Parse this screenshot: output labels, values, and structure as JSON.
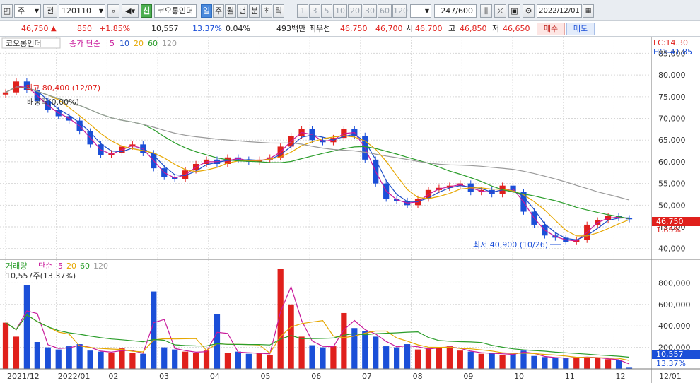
{
  "toolbar": {
    "period": "주",
    "prev_label": "전",
    "code": "120110",
    "badge": "신",
    "stock_name": "코오롱인더",
    "interval_tabs": [
      "일",
      "주",
      "월",
      "년",
      "분",
      "초",
      "틱"
    ],
    "active_interval": "일",
    "number_tabs": [
      "1",
      "3",
      "5",
      "10",
      "20",
      "30",
      "60",
      "120"
    ],
    "count": "247",
    "count_total": "/600",
    "date": "2022/12/01"
  },
  "quote": {
    "price": "46,750",
    "change_arrow": "▲",
    "change": "850",
    "change_pct": "+1.85%",
    "volume": "10,557",
    "volume_pct": "13.37%",
    "turnover": "0.04%",
    "amount": "493백만",
    "best_label": "최우선",
    "best_ask": "46,750",
    "best_bid": "46,700",
    "open_label": "시",
    "open": "46,700",
    "high_label": "고",
    "high": "46,850",
    "low_label": "저",
    "low": "46,650",
    "buy_button": "매수",
    "sell_button": "매도"
  },
  "price_panel": {
    "name": "코오롱인더",
    "ma_label": "종가 단순",
    "ma_periods": [
      "5",
      "10",
      "20",
      "60",
      "120"
    ],
    "lc": "LC:14.30",
    "hc": "HC:-41.85",
    "high_note": "최고 80,400 (12/07)",
    "ex_note": "배당락(0.00%)",
    "low_note": "최저 40,900 (10/26)",
    "current_price": "46,750",
    "current_pct": "1.85%"
  },
  "volume_panel": {
    "title": "거래량",
    "ma_label": "단순",
    "ma_periods": [
      "5",
      "20",
      "60",
      "120"
    ],
    "value_line": "10,557주(13.37%)",
    "current_volume": "10,557",
    "current_pct": "13.37%"
  },
  "colors": {
    "up": "#e0201c",
    "down": "#1b4fd8",
    "ma5": "#c8189a",
    "ma10": "#1e4fc8",
    "ma20": "#e6a700",
    "ma60": "#2a9d2a",
    "ma120": "#9a9a9a"
  },
  "chart_data": {
    "type": "line",
    "x_labels": [
      "2021/12",
      "2022/01",
      "02",
      "03",
      "04",
      "05",
      "06",
      "07",
      "08",
      "09",
      "10",
      "11",
      "12",
      "12/01"
    ],
    "price_axis": [
      "85,000",
      "80,000",
      "75,000",
      "70,000",
      "65,000",
      "60,000",
      "55,000",
      "50,000",
      "45,000",
      "40,000"
    ],
    "price_range": [
      38000,
      88000
    ],
    "volume_axis": [
      "800,000",
      "600,000",
      "400,000",
      "200,000"
    ],
    "volume_range": [
      0,
      1000000
    ],
    "series": [
      {
        "name": "종가",
        "values": [
          76000,
          78500,
          76500,
          74000,
          72000,
          70500,
          69500,
          67000,
          64000,
          61500,
          62000,
          63500,
          64000,
          62000,
          58500,
          56500,
          56000,
          58000,
          59500,
          60500,
          59500,
          61000,
          60500,
          60000,
          60500,
          61000,
          63500,
          66000,
          67500,
          65000,
          64500,
          65500,
          67500,
          66000,
          60500,
          55000,
          51500,
          51000,
          50000,
          51500,
          53500,
          54000,
          54500,
          55000,
          53000,
          53500,
          52500,
          54500,
          53000,
          48500,
          45500,
          43000,
          42500,
          41500,
          42000,
          45500,
          46500,
          47500,
          47000,
          46750
        ]
      }
    ],
    "volume_series": {
      "name": "거래량",
      "values": [
        430000,
        300000,
        780000,
        250000,
        200000,
        180000,
        210000,
        230000,
        170000,
        160000,
        150000,
        190000,
        150000,
        140000,
        720000,
        200000,
        180000,
        160000,
        150000,
        170000,
        510000,
        150000,
        160000,
        140000,
        150000,
        130000,
        930000,
        600000,
        300000,
        220000,
        200000,
        210000,
        520000,
        380000,
        350000,
        300000,
        210000,
        200000,
        230000,
        180000,
        190000,
        200000,
        210000,
        170000,
        160000,
        140000,
        150000,
        130000,
        140000,
        170000,
        120000,
        110000,
        100000,
        100000,
        110000,
        110000,
        100000,
        90000,
        80000,
        10557
      ]
    }
  }
}
